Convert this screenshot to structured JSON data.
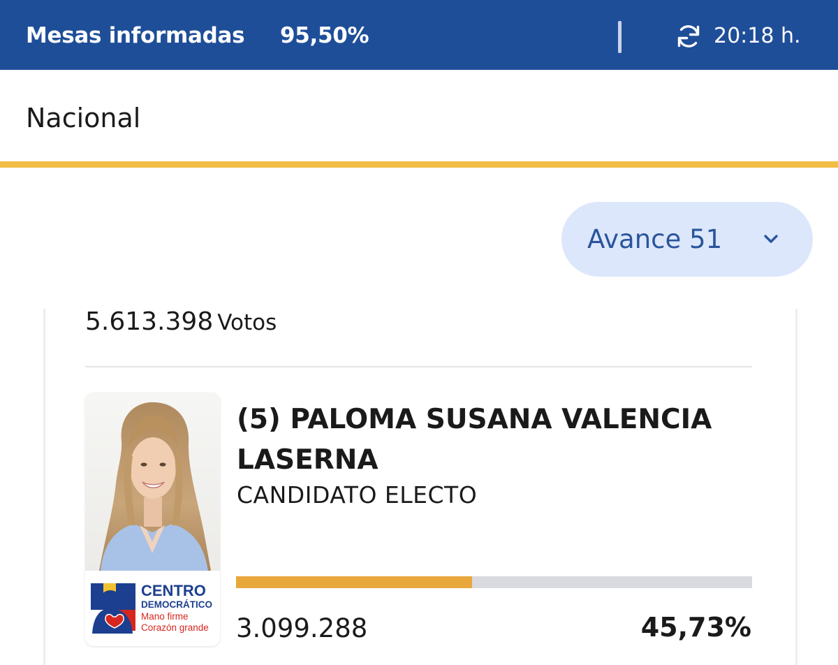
{
  "header": {
    "label": "Mesas informadas",
    "percentage": "95,50%",
    "time": "20:18 h.",
    "refresh_icon": "refresh-icon"
  },
  "scope": "Nacional",
  "avance": {
    "label": "Avance 51",
    "chevron_icon": "chevron-down-icon"
  },
  "summary": {
    "total_votes": "5.613.398",
    "votes_unit": "Votos"
  },
  "candidate": {
    "name": "(5) PALOMA SUSANA VALENCIA LASERNA",
    "status": "CANDIDATO ELECTO",
    "votes": "3.099.288",
    "percentage": "45,73%",
    "share": 0.4573,
    "party_logo": {
      "line1": "CENTRO",
      "line2": "DEMOCRÁTICO",
      "line3": "Mano firme",
      "line4": "Corazón grande"
    }
  },
  "colors": {
    "header_bg": "#1f4e99",
    "accent_yellow": "#f1bd45",
    "bar_fill": "#e9a83c",
    "bar_bg": "#d9d9e0",
    "pill_bg": "#dce7fb",
    "pill_text": "#2a549c"
  }
}
